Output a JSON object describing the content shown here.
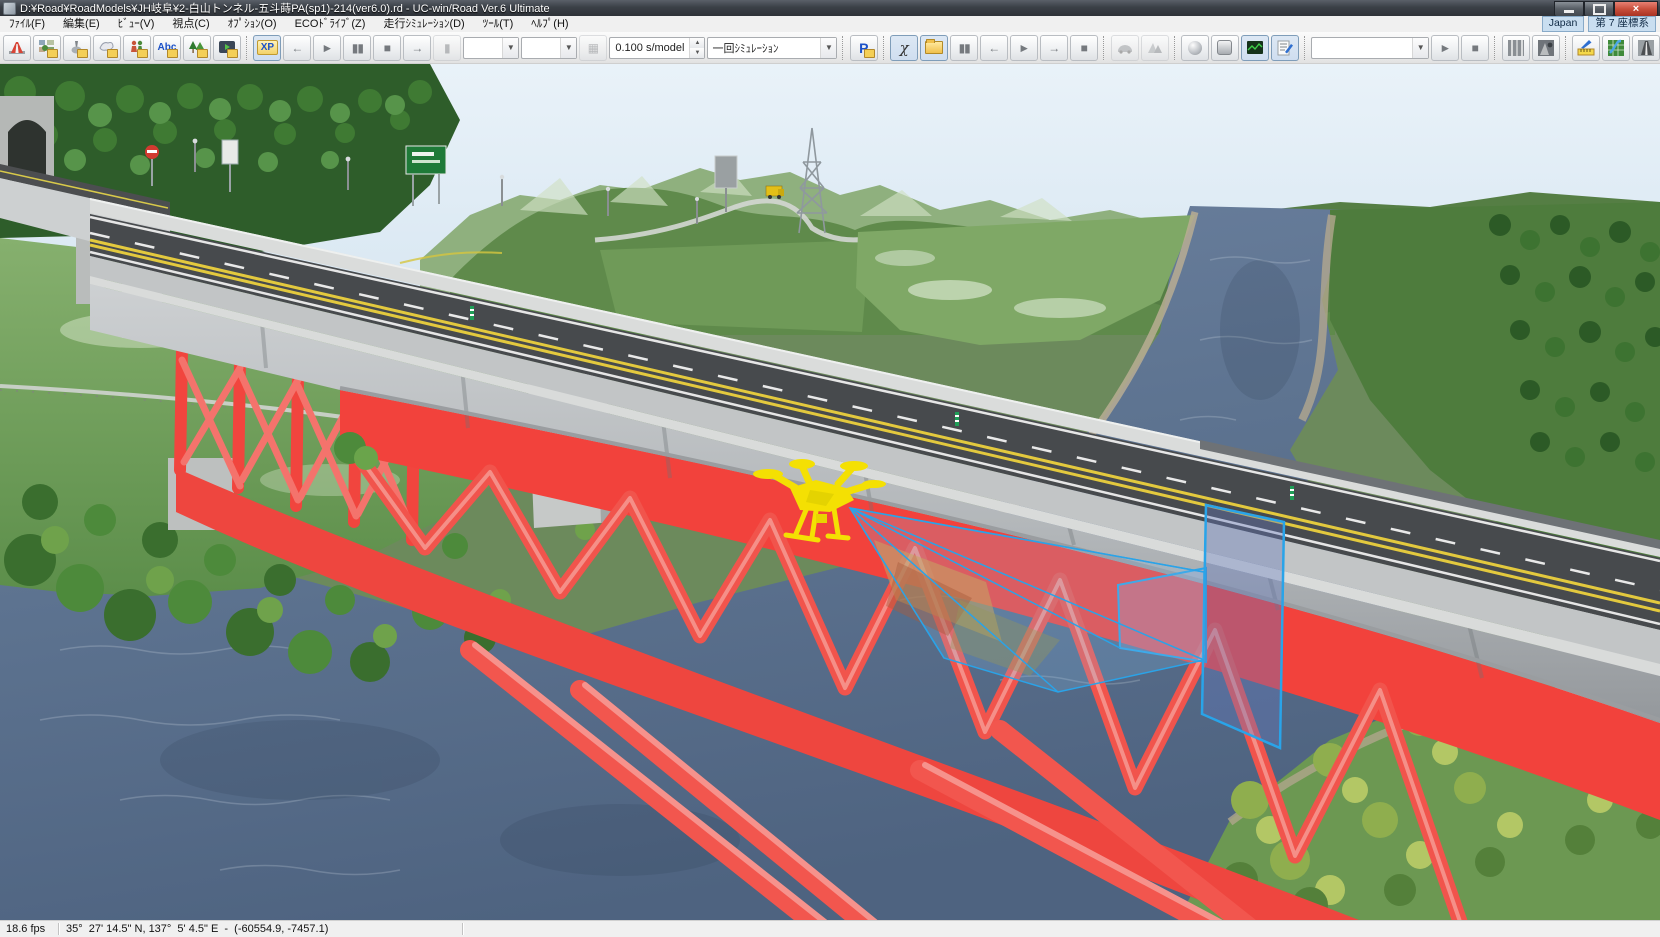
{
  "window": {
    "title": "D:¥Road¥RoadModels¥JH岐阜¥2-白山トンネル-五斗蒔PA(sp1)-214(ver6.0).rd - UC-win/Road Ver.6 Ultimate",
    "close_label": "×"
  },
  "menu": {
    "items": [
      "ﾌｧｲﾙ(F)",
      "編集(E)",
      "ﾋﾞｭｰ(V)",
      "視点(C)",
      "ｵﾌﾟｼｮﾝ(O)",
      "ECOﾄﾞﾗｲﾌﾞ(Z)",
      "走行ｼﾐｭﾚｰｼｮﾝ(D)",
      "ﾂｰﾙ(T)",
      "ﾍﾙﾌﾟ(H)"
    ],
    "locale": "Japan",
    "coord_system": "第 7 座標系"
  },
  "toolbar": {
    "xp_label": "XP",
    "abc_label": "Abc",
    "parking_label": "P",
    "script_label": "χ",
    "speed_value": "0.100 s/model",
    "sim_mode": "一回ｼﾐｭﾚｰｼｮﾝ",
    "back_glyph": "←",
    "play_glyph": "►",
    "pause_glyph": "▮▮",
    "stop_glyph": "■",
    "forward_glyph": "→"
  },
  "status": {
    "fps": "18.6 fps",
    "position": "35°  27' 14.5\" N, 137°  5' 4.5\" E  -  (-60554.9, -7457.1)"
  },
  "colors": {
    "truss_red": "#f2423c",
    "selection_blue": "#29a4e9",
    "drone_yellow": "#f4e003",
    "water_blue": "#5d7390"
  }
}
